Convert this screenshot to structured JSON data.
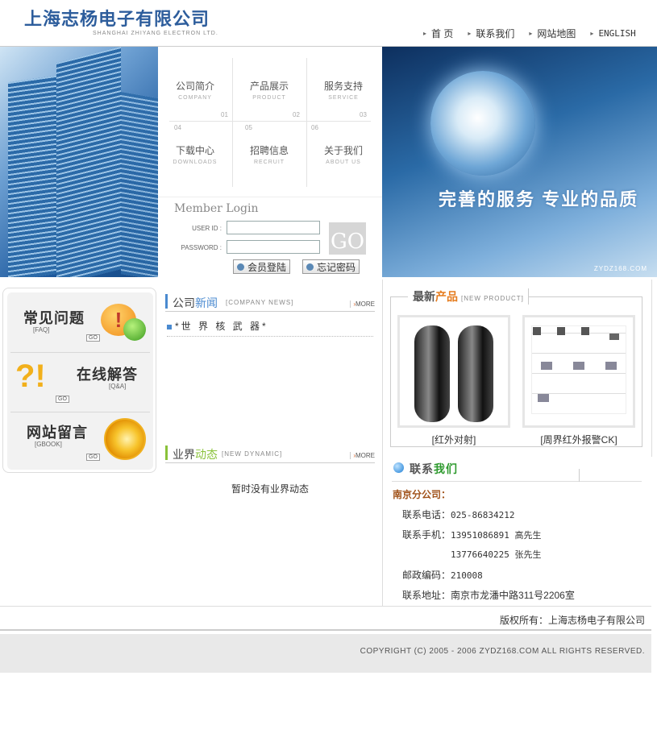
{
  "header": {
    "company_cn": "上海志杨电子有限公司",
    "company_en": "SHANGHAI ZHIYANG ELECTRON LTD.",
    "nav": [
      "首 页",
      "联系我们",
      "网站地图",
      "ENGLISH"
    ]
  },
  "banner": {
    "slogan": "完善的服务  专业的品质",
    "site": "ZYDZ168.COM",
    "menu": [
      {
        "cn": "公司简介",
        "en": "COMPANY",
        "num": "01"
      },
      {
        "cn": "产品展示",
        "en": "PRODUCT",
        "num": "02"
      },
      {
        "cn": "服务支持",
        "en": "SERVICE",
        "num": "03"
      },
      {
        "cn": "下载中心",
        "en": "DOWNLOADS",
        "num": "04"
      },
      {
        "cn": "招聘信息",
        "en": "RECRUIT",
        "num": "05"
      },
      {
        "cn": "关于我们",
        "en": "ABOUT US",
        "num": "06"
      }
    ]
  },
  "login": {
    "title": "Member Login",
    "user_label": "USER ID :",
    "pass_label": "PASSWORD :",
    "user_value": "",
    "pass_value": "",
    "go": "GO",
    "member_btn": "会员登陆",
    "forgot_btn": "忘记密码"
  },
  "left_box": {
    "faq": {
      "title": "常见问题",
      "sub": "[FAQ]",
      "go": "GO"
    },
    "qa": {
      "title": "在线解答",
      "sub": "[Q&A]",
      "go": "GO"
    },
    "gbook": {
      "title": "网站留言",
      "sub": "[GBOOK]",
      "go": "GO"
    }
  },
  "news": {
    "title_a": "公司",
    "title_b": "新闻",
    "sub": "[COMPANY NEWS]",
    "more": "MORE",
    "items": [
      "*世 界 核 武 器*"
    ]
  },
  "dynamic": {
    "title_a": "业界",
    "title_b": "动态",
    "sub": "[NEW DYNAMIC]",
    "more": "MORE",
    "empty": "暂时没有业界动态"
  },
  "products": {
    "title_a": "最新",
    "title_b": "产品",
    "sub": "[NEW PRODUCT]",
    "items": [
      "[红外对射]",
      "[周界红外报警CK]"
    ]
  },
  "contact": {
    "title_a": "联系",
    "title_b": "我们",
    "branch": "南京分公司：",
    "rows": [
      {
        "label": "联系电话：",
        "value": "025-86834212"
      },
      {
        "label": "联系手机：",
        "value": "13951086891  高先生"
      },
      {
        "label": "",
        "value": "13776640225  张先生"
      },
      {
        "label": "邮政编码：",
        "value": "210008"
      },
      {
        "label": "联系地址：",
        "value": "南京市龙潘中路311号2206室"
      }
    ]
  },
  "footer": {
    "owner": "版权所有：上海志杨电子有限公司",
    "copyright": "COPYRIGHT (C) 2005 - 2006 ZYDZ168.COM ALL RIGHTS RESERVED."
  }
}
